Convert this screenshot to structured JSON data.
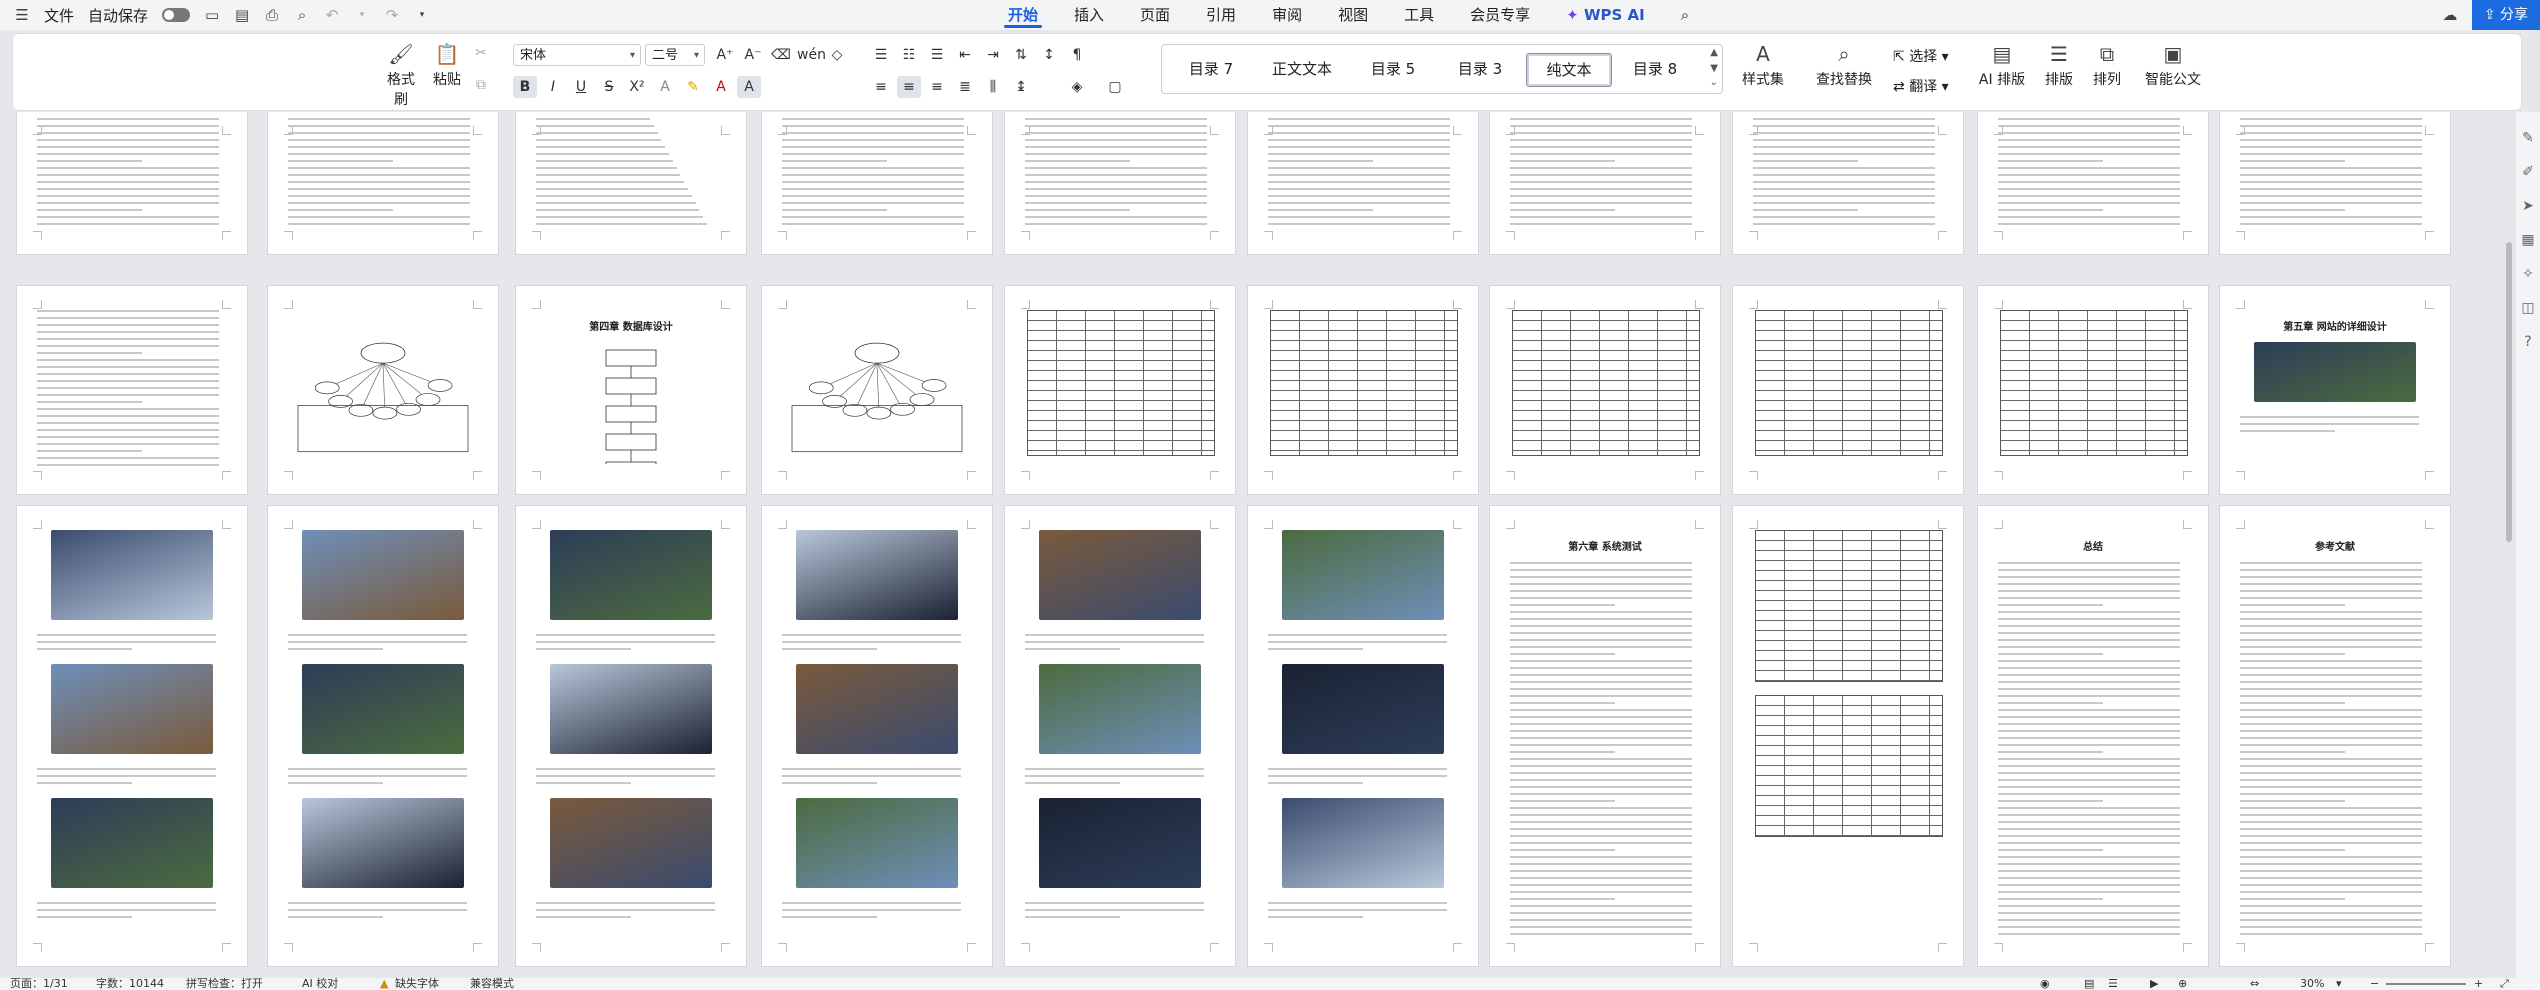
{
  "titlebar": {
    "file_label": "文件",
    "autosave_label": "自动保存",
    "tabs": [
      "开始",
      "插入",
      "页面",
      "引用",
      "审阅",
      "视图",
      "工具",
      "会员专享"
    ],
    "wps_ai_label": "WPS AI",
    "share_label": "分享"
  },
  "ribbon": {
    "format_painter": "格式刷",
    "paste": "粘贴",
    "font_name": "宋体",
    "font_size": "二号",
    "styles": [
      "目录 7",
      "正文文本",
      "目录 5",
      "目录 3",
      "纯文本",
      "目录 8"
    ],
    "selected_style": "纯文本",
    "style_set": "样式集",
    "find_replace": "查找替换",
    "select": "选择",
    "translate": "翻译",
    "ai_layout": "AI 排版",
    "layout": "排版",
    "arrange": "排列",
    "smart_doc": "智能公文"
  },
  "pages": {
    "row2_titles": [
      "第四章  数据库设计",
      "第五章  网站的详细设计"
    ],
    "row3_titles": [
      "第六章  系统测试",
      "总结",
      "参考文献"
    ]
  },
  "status": {
    "page": "页面：1/31",
    "words": "字数：10144",
    "spell": "拼写检查：打开",
    "ai_check": "AI 校对",
    "font_missing": "缺失字体",
    "compat": "兼容模式",
    "zoom": "30%"
  }
}
